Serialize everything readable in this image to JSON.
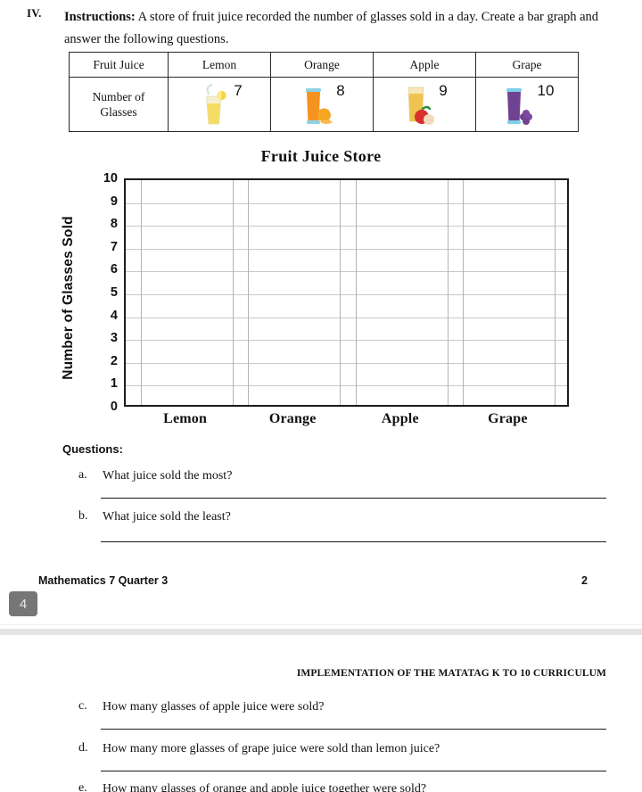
{
  "instructions": {
    "numeral": "IV.",
    "label": "Instructions:",
    "body": " A store of fruit juice recorded the number of glasses sold in a day. Create a bar graph and answer the following questions."
  },
  "data_table": {
    "row_headers": [
      "Fruit Juice",
      "Number of Glasses"
    ],
    "row_header_line1": "Number of",
    "row_header_line2": "Glasses",
    "columns": [
      {
        "name": "Lemon",
        "value": "7",
        "icon": "lemon-juice-glass-icon"
      },
      {
        "name": "Orange",
        "value": "8",
        "icon": "orange-juice-glass-icon"
      },
      {
        "name": "Apple",
        "value": "9",
        "icon": "apple-juice-glass-icon"
      },
      {
        "name": "Grape",
        "value": "10",
        "icon": "grape-juice-glass-icon"
      }
    ]
  },
  "chart_data": {
    "type": "bar",
    "title": "Fruit Juice Store",
    "xlabel": "",
    "ylabel": "Number of Glasses Sold",
    "categories": [
      "Lemon",
      "Orange",
      "Apple",
      "Grape"
    ],
    "values": [
      0,
      0,
      0,
      0
    ],
    "reference_values": [
      7,
      8,
      9,
      10
    ],
    "ylim": [
      0,
      10
    ],
    "yticks": [
      "10",
      "9",
      "8",
      "7",
      "6",
      "5",
      "4",
      "3",
      "2",
      "1",
      "0"
    ],
    "grid": true,
    "legend": "none",
    "note": "blank grid template - bars not drawn, student fills in"
  },
  "questions": {
    "heading": "Questions:",
    "items": [
      {
        "letter": "a.",
        "text": "What juice sold the most?"
      },
      {
        "letter": "b.",
        "text": "What juice sold the least?"
      }
    ]
  },
  "footer": {
    "left": "Mathematics 7 Quarter 3",
    "right": "2",
    "page_badge": "4"
  },
  "page_two": {
    "header": "IMPLEMENTATION OF THE MATATAG K TO 10 CURRICULUM",
    "items": [
      {
        "letter": "c.",
        "text": "How many glasses of apple juice were sold?"
      },
      {
        "letter": "d.",
        "text": "How many more glasses of grape juice were sold than lemon juice?"
      },
      {
        "letter": "e.",
        "text": "How many glasses of orange and apple juice together were sold?"
      }
    ]
  },
  "colors": {
    "lemon": "#f2d54e",
    "orange": "#f09020",
    "apple": "#e8b03a",
    "grape": "#7b4a9e",
    "badge": "#767676"
  }
}
